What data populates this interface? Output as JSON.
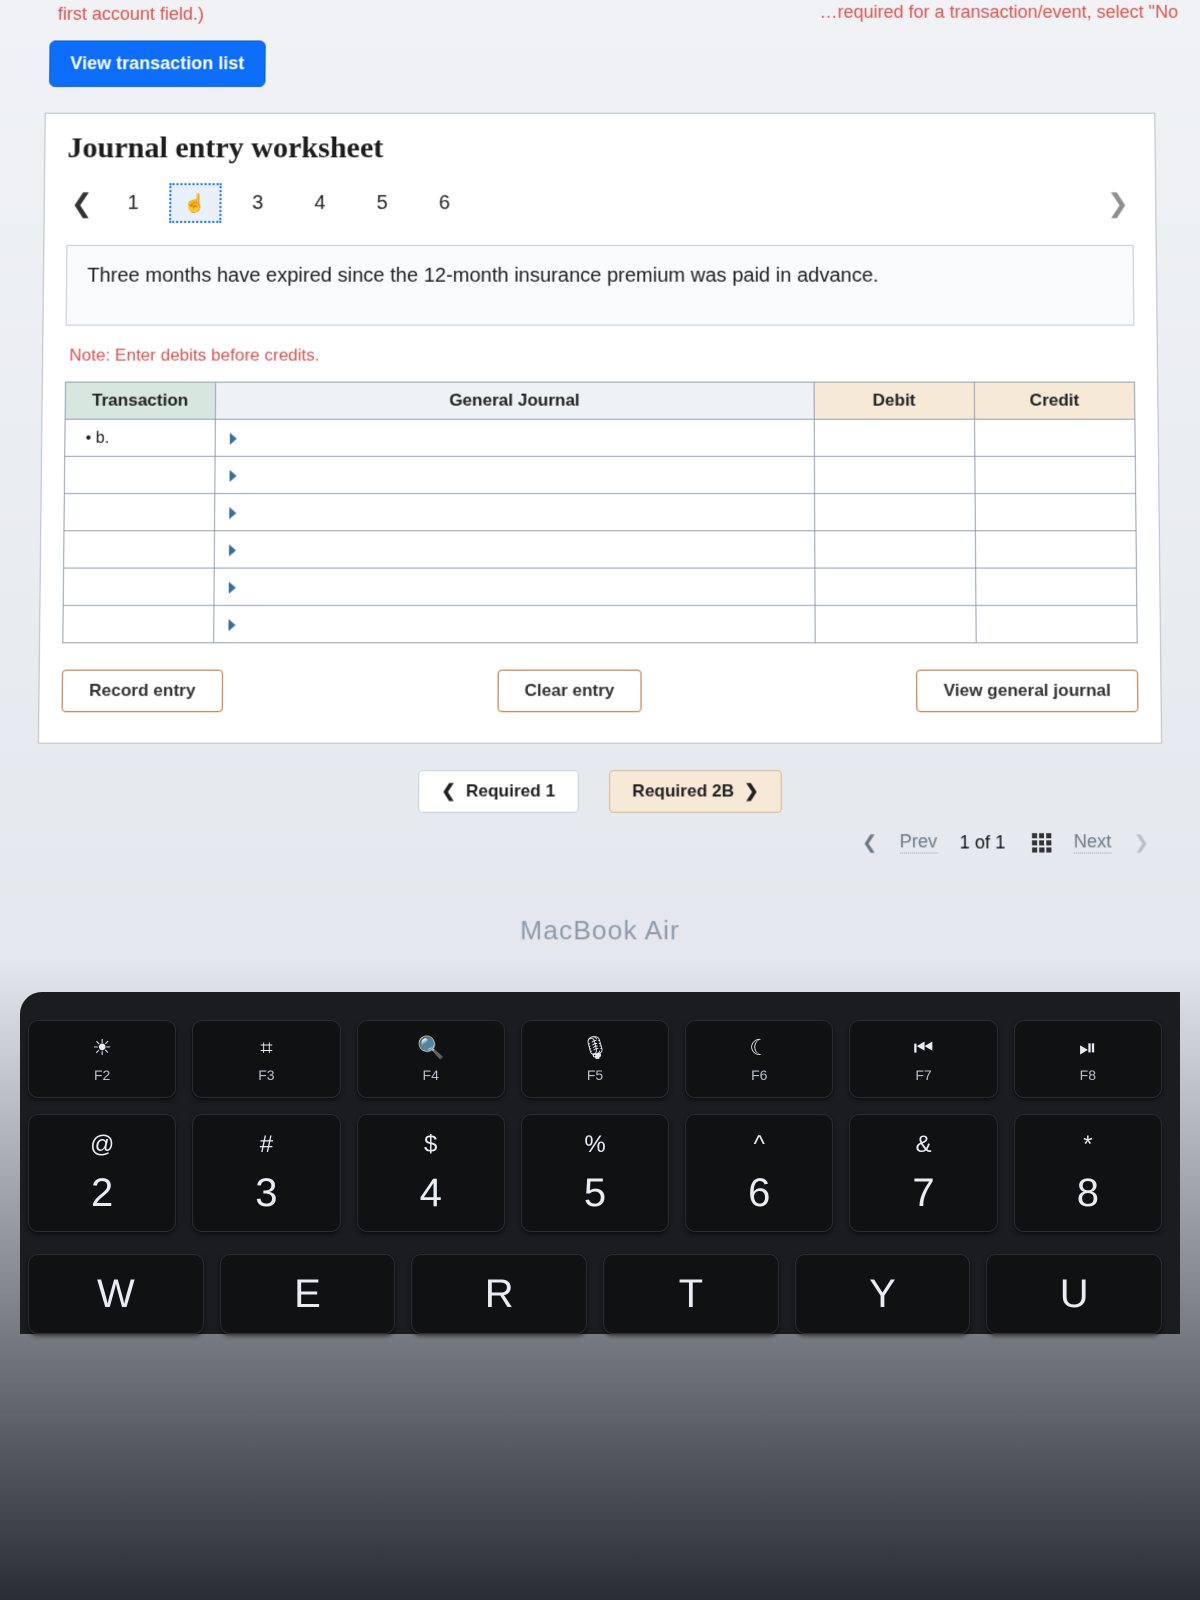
{
  "hint_fragment_left": "first account field.)",
  "hint_fragment_right": "…required for a transaction/event, select \"No",
  "view_list_btn": "View transaction list",
  "worksheet_title": "Journal entry worksheet",
  "pager": {
    "items": [
      "1",
      "",
      "3",
      "4",
      "5",
      "6"
    ],
    "active_index": 1,
    "active_glyph": "☝"
  },
  "prompt": "Three months have expired since the 12-month insurance premium was paid in advance.",
  "note": "Note: Enter debits before credits.",
  "table": {
    "headers": {
      "transaction": "Transaction",
      "general": "General Journal",
      "debit": "Debit",
      "credit": "Credit"
    },
    "first_row_label": "b.",
    "blank_rows": 5
  },
  "actions": {
    "record": "Record entry",
    "clear": "Clear entry",
    "view_gj": "View general journal"
  },
  "req_nav": {
    "prev": "Required 1",
    "next": "Required 2B"
  },
  "step": {
    "prev": "Prev",
    "counter": "1 of 1",
    "next": "Next"
  },
  "hardware_label": "MacBook Air",
  "fkeys": [
    {
      "icon": "☀",
      "label": "F2"
    },
    {
      "icon": "⌗",
      "label": "F3"
    },
    {
      "icon": "🔍",
      "label": "F4"
    },
    {
      "icon": "🎙",
      "label": "F5"
    },
    {
      "icon": "☾",
      "label": "F6"
    },
    {
      "icon": "⏮",
      "label": "F7"
    },
    {
      "icon": "⏯",
      "label": "F8"
    }
  ],
  "numkeys": [
    {
      "sym": "@",
      "num": "2"
    },
    {
      "sym": "#",
      "num": "3"
    },
    {
      "sym": "$",
      "num": "4"
    },
    {
      "sym": "%",
      "num": "5"
    },
    {
      "sym": "^",
      "num": "6"
    },
    {
      "sym": "&",
      "num": "7"
    },
    {
      "sym": "*",
      "num": "8"
    }
  ],
  "letterkeys": [
    "W",
    "E",
    "R",
    "T",
    "Y",
    "U"
  ]
}
